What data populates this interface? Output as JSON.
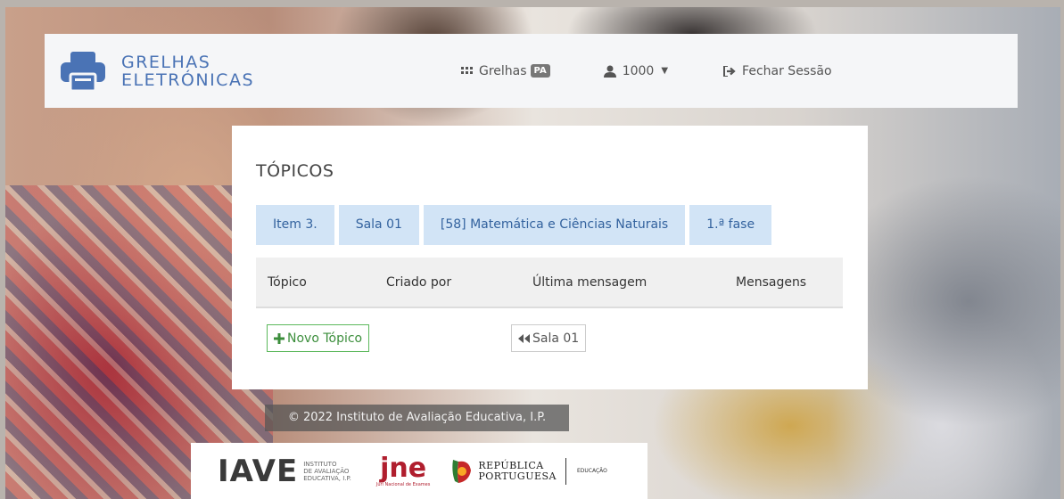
{
  "brand": {
    "line1": "GRELHAS",
    "line2": "ELETRÓNICAS",
    "icon": "printer-icon",
    "color": "#4a73b5"
  },
  "nav": {
    "grelhas_label": "Grelhas",
    "grelhas_badge": "PA",
    "user_label": "1000",
    "logout_label": "Fechar Sessão"
  },
  "page": {
    "title": "TÓPICOS",
    "breadcrumbs": [
      "Item 3.",
      "Sala 01",
      "[58] Matemática e Ciências Naturais",
      "1.ª fase"
    ]
  },
  "table": {
    "columns": [
      "Tópico",
      "Criado por",
      "Última mensagem",
      "Mensagens"
    ],
    "rows": []
  },
  "actions": {
    "new_topic": "Novo Tópico",
    "back_room": "Sala 01"
  },
  "footer": {
    "copyright": "© 2022 Instituto de Avaliação Educativa, I.P.",
    "iave": "IAVE",
    "iave_sub1": "INSTITUTO",
    "iave_sub2": "DE AVALIAÇÃO",
    "iave_sub3": "EDUCATIVA, I.P.",
    "jne": "jne",
    "jne_sub": "Júri Nacional de Exames",
    "rp_line1": "REPÚBLICA",
    "rp_line2": "PORTUGUESA",
    "rp_edu": "EDUCAÇÃO"
  },
  "colors": {
    "accent": "#4a73b5",
    "crumb_bg": "#d2e4f6",
    "success": "#5cb85c"
  }
}
